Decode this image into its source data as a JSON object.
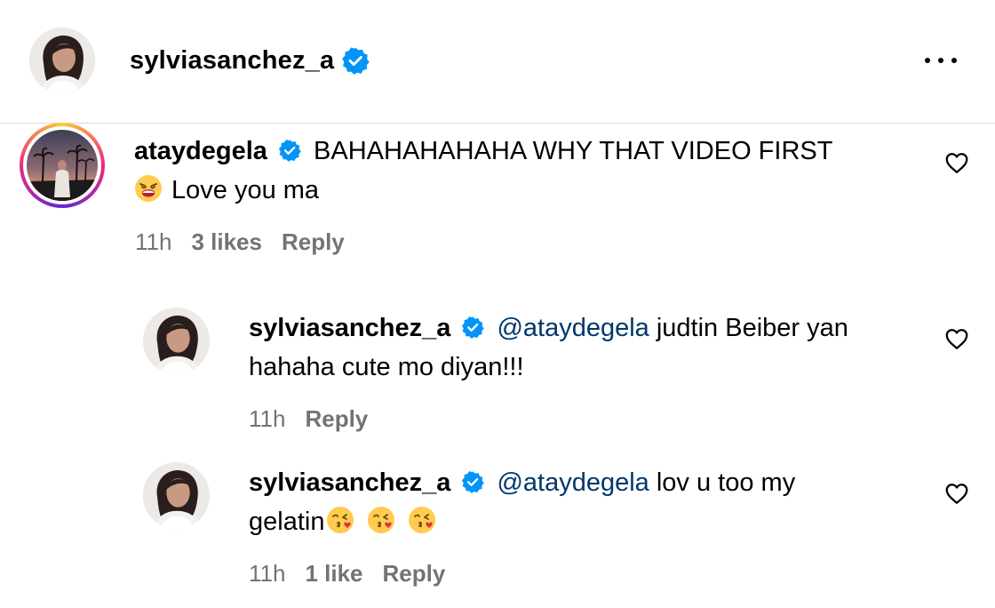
{
  "post_header": {
    "username": "sylviasanchez_a",
    "verified_icon": "verified-badge-icon",
    "more_icon": "more-options-icon"
  },
  "comments": [
    {
      "username": "ataydegela",
      "verified": true,
      "text_line1": "BAHAHAHAHAHA WHY THAT VIDEO FIRST",
      "emoji": "weary-face-emoji",
      "text_line2": "Love you ma",
      "time": "11h",
      "likes": "3 likes",
      "reply": "Reply",
      "has_story_ring": true
    },
    {
      "username": "sylviasanchez_a",
      "verified": true,
      "mention": "@ataydegela",
      "text_line1": "judtin Beiber yan",
      "text_line2": "hahaha cute mo diyan!!!",
      "time": "11h",
      "reply": "Reply"
    },
    {
      "username": "sylviasanchez_a",
      "verified": true,
      "mention": "@ataydegela",
      "text_line1": "lov u too my",
      "text_line2": "gelatin",
      "emoji": "face-blowing-kiss-emoji",
      "time": "11h",
      "likes": "1 like",
      "reply": "Reply"
    }
  ],
  "colors": {
    "verified_blue": "#0095f6",
    "mention_blue": "#00376b",
    "meta_gray": "#737373",
    "divider": "#dbdbdb"
  }
}
